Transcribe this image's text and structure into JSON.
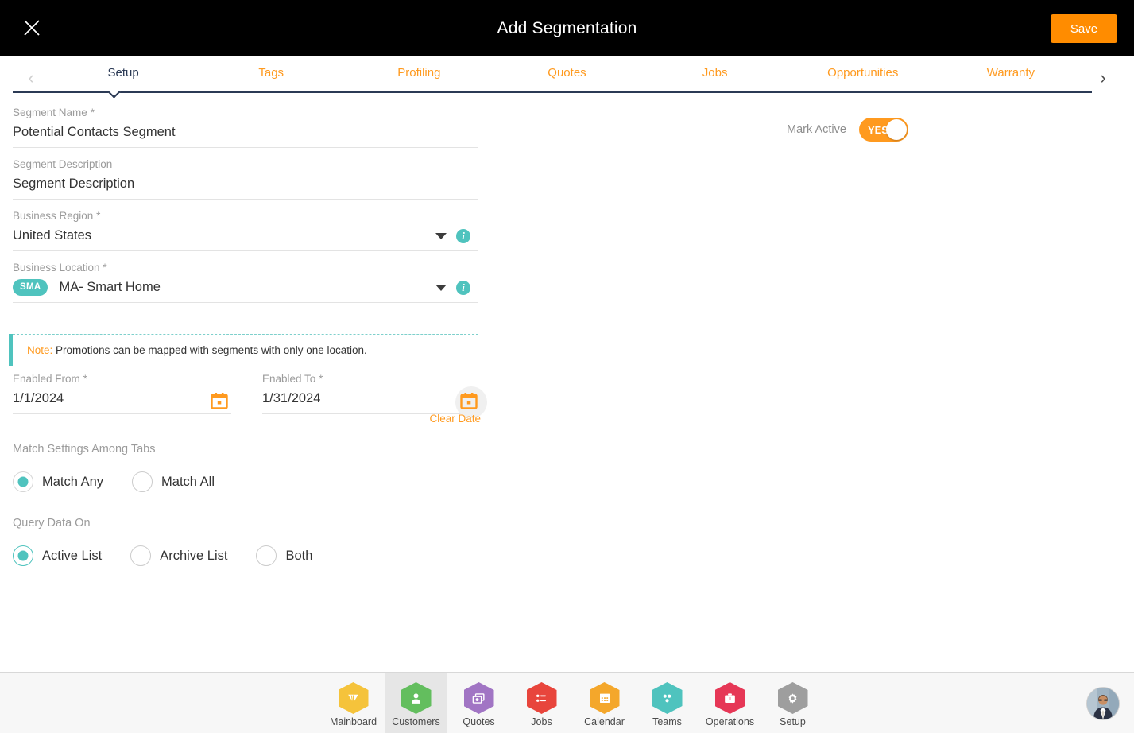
{
  "header": {
    "title": "Add Segmentation",
    "close_icon": "close-icon",
    "save_label": "Save"
  },
  "tabs": {
    "prev_arrow": "‹",
    "next_arrow": "›",
    "items": [
      {
        "label": "Setup",
        "active": true
      },
      {
        "label": "Tags",
        "active": false
      },
      {
        "label": "Profiling",
        "active": false
      },
      {
        "label": "Quotes",
        "active": false
      },
      {
        "label": "Jobs",
        "active": false
      },
      {
        "label": "Opportunities",
        "active": false
      },
      {
        "label": "Warranty",
        "active": false
      }
    ]
  },
  "form": {
    "segment_name": {
      "label": "Segment Name",
      "required": "*",
      "value": "Potential Contacts Segment"
    },
    "segment_description": {
      "label": "Segment Description",
      "required": "",
      "value": "Segment Description"
    },
    "business_region": {
      "label": "Business Region",
      "required": "*",
      "value": "United States",
      "info_icon": "info-icon",
      "caret_icon": "chevron-down-icon"
    },
    "business_location": {
      "label": "Business Location",
      "required": "*",
      "badge": "SMA",
      "value": "MA- Smart Home",
      "info_icon": "info-icon",
      "caret_icon": "chevron-down-icon"
    },
    "mark_active": {
      "label": "Mark Active",
      "toggle_value": "YES",
      "on": true
    },
    "note": {
      "label": "Note:",
      "text": "Promotions can be mapped with segments with only one location."
    },
    "enabled_from": {
      "label": "Enabled From",
      "required": "*",
      "value": "1/1/2024",
      "calendar_icon": "calendar-icon"
    },
    "enabled_to": {
      "label": "Enabled To",
      "required": "*",
      "value": "1/31/2024",
      "calendar_icon": "calendar-icon"
    },
    "clear_date_label": "Clear Date",
    "match_settings": {
      "label": "Match Settings Among Tabs",
      "options": [
        {
          "label": "Match Any",
          "selected": true
        },
        {
          "label": "Match All",
          "selected": false
        }
      ]
    },
    "query_data_on": {
      "label": "Query Data On",
      "options": [
        {
          "label": "Active List",
          "selected": true
        },
        {
          "label": "Archive List",
          "selected": false
        },
        {
          "label": "Both",
          "selected": false
        }
      ]
    }
  },
  "bottom_nav": {
    "items": [
      {
        "label": "Mainboard",
        "icon": "mainboard-icon",
        "color": "#F5C33B",
        "active": false
      },
      {
        "label": "Customers",
        "icon": "customers-icon",
        "color": "#63BE5E",
        "active": true
      },
      {
        "label": "Quotes",
        "icon": "quotes-icon",
        "color": "#A175C4",
        "active": false
      },
      {
        "label": "Jobs",
        "icon": "jobs-icon",
        "color": "#E8453C",
        "active": false
      },
      {
        "label": "Calendar",
        "icon": "calendar-icon",
        "color": "#F4A72B",
        "active": false
      },
      {
        "label": "Teams",
        "icon": "teams-icon",
        "color": "#4FC3BE",
        "active": false
      },
      {
        "label": "Operations",
        "icon": "operations-icon",
        "color": "#E63756",
        "active": false
      },
      {
        "label": "Setup",
        "icon": "setup-gear-icon",
        "color": "#9E9E9E",
        "active": false
      }
    ],
    "avatar": "user-avatar"
  },
  "colors": {
    "accent_orange": "#FF8C00",
    "tab_orange": "#FF9A1F",
    "teal": "#4FC3BE",
    "navy": "#2b3a55",
    "topbar": "#000000"
  }
}
